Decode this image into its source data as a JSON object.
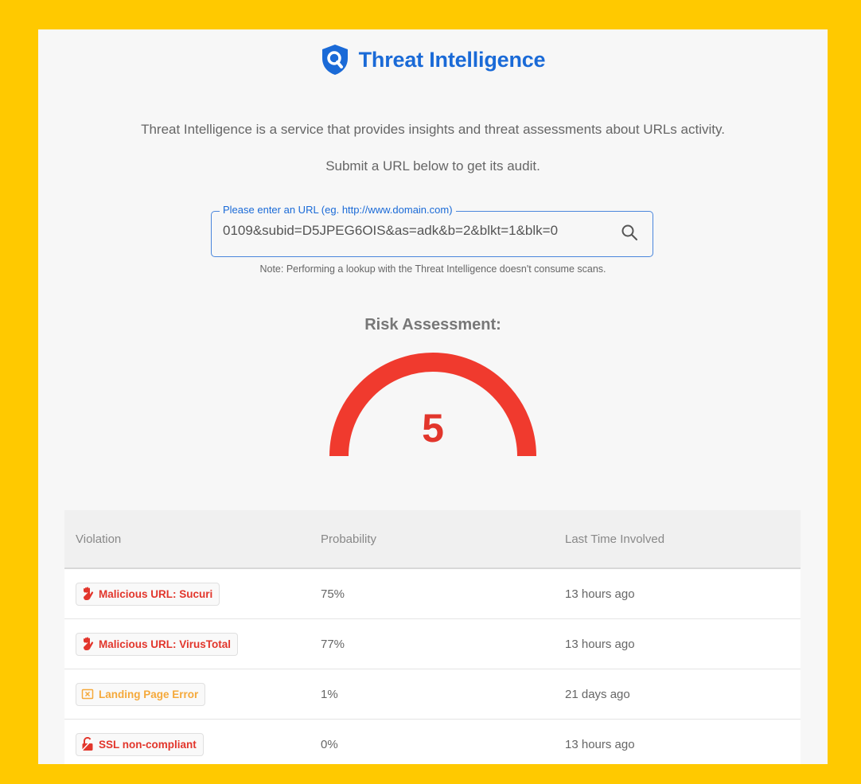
{
  "brand": {
    "title": "Threat Intelligence"
  },
  "intro": {
    "line1": "Threat Intelligence is a service that provides insights and threat assessments about URLs activity.",
    "line2": "Submit a URL below to get its audit."
  },
  "url_input": {
    "label": "Please enter an URL (eg. http://www.domain.com)",
    "value": "0109&subid=D5JPEG6OIS&as=adk&b=2&blkt=1&blk=0"
  },
  "note": "Note: Performing a lookup with the Threat Intelligence doesn't consume scans.",
  "risk": {
    "title": "Risk Assessment:",
    "score": "5",
    "gauge_color": "#f03a2e"
  },
  "table": {
    "headers": [
      "Violation",
      "Probability",
      "Last Time Involved"
    ],
    "rows": [
      {
        "violation": "Malicious URL: Sucuri",
        "icon": "hand-stop-icon",
        "tone": "red",
        "probability": "75%",
        "last": "13 hours ago"
      },
      {
        "violation": "Malicious URL: VirusTotal",
        "icon": "hand-stop-icon",
        "tone": "red",
        "probability": "77%",
        "last": "13 hours ago"
      },
      {
        "violation": "Landing Page Error",
        "icon": "error-box-icon",
        "tone": "orange",
        "probability": "1%",
        "last": "21 days ago"
      },
      {
        "violation": "SSL non-compliant",
        "icon": "unlocked-icon",
        "tone": "red",
        "probability": "0%",
        "last": "13 hours ago"
      }
    ]
  },
  "colors": {
    "accent": "#1a6ad7",
    "danger": "#e2362c",
    "warning": "#f5a93b",
    "frame": "#ffc900"
  }
}
